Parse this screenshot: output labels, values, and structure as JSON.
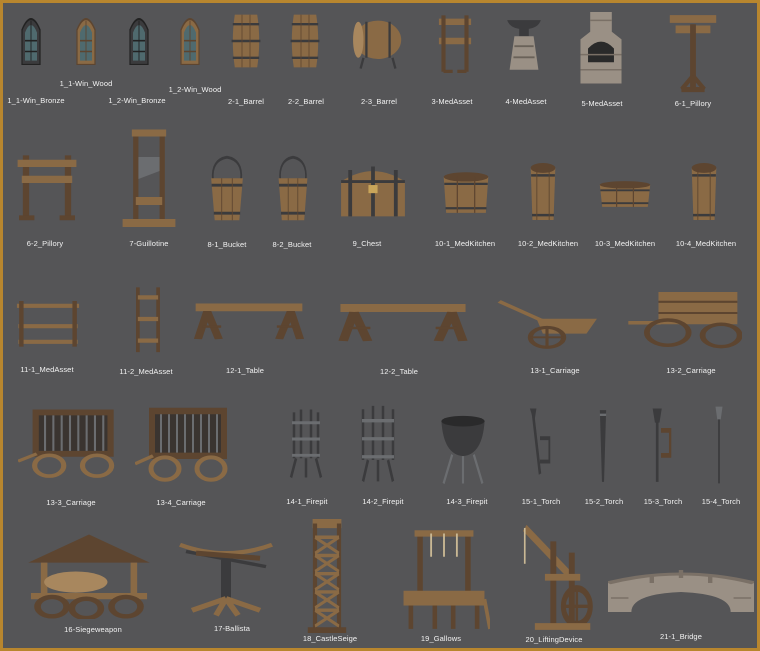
{
  "colors": {
    "frame": "#b8862e",
    "background": "#555557",
    "label": "#f2f2f2",
    "wood": "#8a6a45",
    "metal": "#3b3b3d"
  },
  "assets": [
    {
      "label": "1_1-Win_Bronze",
      "icon": "window-icon"
    },
    {
      "label": "1_1-Win_Wood",
      "icon": "window-icon"
    },
    {
      "label": "1_2-Win_Bronze",
      "icon": "window-icon"
    },
    {
      "label": "1_2-Win_Wood",
      "icon": "window-icon"
    },
    {
      "label": "2-1_Barrel",
      "icon": "barrel-icon"
    },
    {
      "label": "2-2_Barrel",
      "icon": "barrel-icon"
    },
    {
      "label": "2-3_Barrel",
      "icon": "barrel-icon"
    },
    {
      "label": "3-MedAsset",
      "icon": "stand-icon"
    },
    {
      "label": "4-MedAsset",
      "icon": "anvil-icon"
    },
    {
      "label": "5-MedAsset",
      "icon": "forge-icon"
    },
    {
      "label": "6-1_Pillory",
      "icon": "pillory-icon"
    },
    {
      "label": "6-2_Pillory",
      "icon": "pillory-icon"
    },
    {
      "label": "7-Guillotine",
      "icon": "guillotine-icon"
    },
    {
      "label": "8-1_Bucket",
      "icon": "bucket-icon"
    },
    {
      "label": "8-2_Bucket",
      "icon": "bucket-icon"
    },
    {
      "label": "9_Chest",
      "icon": "chest-icon"
    },
    {
      "label": "10-1_MedKitchen",
      "icon": "tub-icon"
    },
    {
      "label": "10-2_MedKitchen",
      "icon": "tub-icon"
    },
    {
      "label": "10-3_MedKitchen",
      "icon": "tub-icon"
    },
    {
      "label": "10-4_MedKitchen",
      "icon": "tub-icon"
    },
    {
      "label": "11-1_MedAsset",
      "icon": "rack-icon"
    },
    {
      "label": "11-2_MedAsset",
      "icon": "rack-icon"
    },
    {
      "label": "12-1_Table",
      "icon": "table-icon"
    },
    {
      "label": "12-2_Table",
      "icon": "table-icon"
    },
    {
      "label": "13-1_Carriage",
      "icon": "cart-icon"
    },
    {
      "label": "13-2_Carriage",
      "icon": "cart-icon"
    },
    {
      "label": "13-3_Carriage",
      "icon": "cage-cart-icon"
    },
    {
      "label": "13-4_Carriage",
      "icon": "cage-cart-icon"
    },
    {
      "label": "14-1_Firepit",
      "icon": "firepit-icon"
    },
    {
      "label": "14-2_Firepit",
      "icon": "firepit-icon"
    },
    {
      "label": "14-3_Firepit",
      "icon": "cauldron-icon"
    },
    {
      "label": "15-1_Torch",
      "icon": "torch-icon"
    },
    {
      "label": "15-2_Torch",
      "icon": "torch-icon"
    },
    {
      "label": "15-3_Torch",
      "icon": "torch-icon"
    },
    {
      "label": "15-4_Torch",
      "icon": "torch-icon"
    },
    {
      "label": "16-Siegeweapon",
      "icon": "siege-weapon-icon"
    },
    {
      "label": "17-Ballista",
      "icon": "ballista-icon"
    },
    {
      "label": "18_CastleSeige",
      "icon": "siege-tower-icon"
    },
    {
      "label": "19_Gallows",
      "icon": "gallows-icon"
    },
    {
      "label": "20_LiftingDevice",
      "icon": "lifting-device-icon"
    },
    {
      "label": "21-1_Bridge",
      "icon": "bridge-icon"
    }
  ]
}
